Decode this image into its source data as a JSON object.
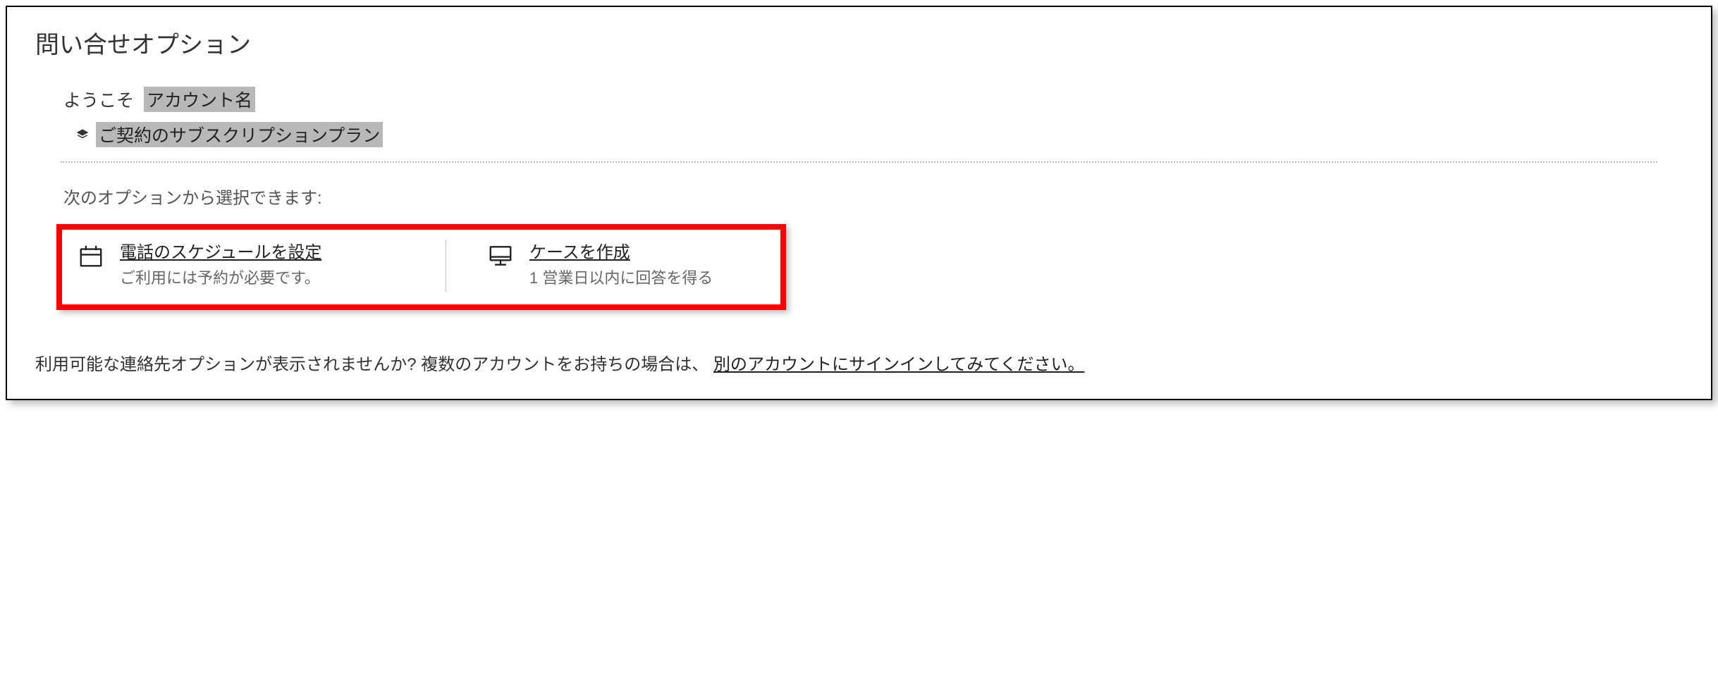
{
  "page": {
    "title": "問い合せオプション"
  },
  "account": {
    "welcome_label": "ようこそ",
    "account_name": "アカウント名",
    "plan_label": "ご契約のサブスクリプションプラン"
  },
  "prompt": "次のオプションから選択できます:",
  "options": [
    {
      "icon": "calendar-icon",
      "title": "電話のスケジュールを設定",
      "description": "ご利用には予約が必要です。"
    },
    {
      "icon": "monitor-icon",
      "title": "ケースを作成",
      "description": "1 営業日以内に回答を得る"
    }
  ],
  "footer": {
    "text_prefix": "利用可能な連絡先オプションが表示されませんか? 複数のアカウントをお持ちの場合は、",
    "link_text": "別のアカウントにサインインしてみてください。"
  }
}
